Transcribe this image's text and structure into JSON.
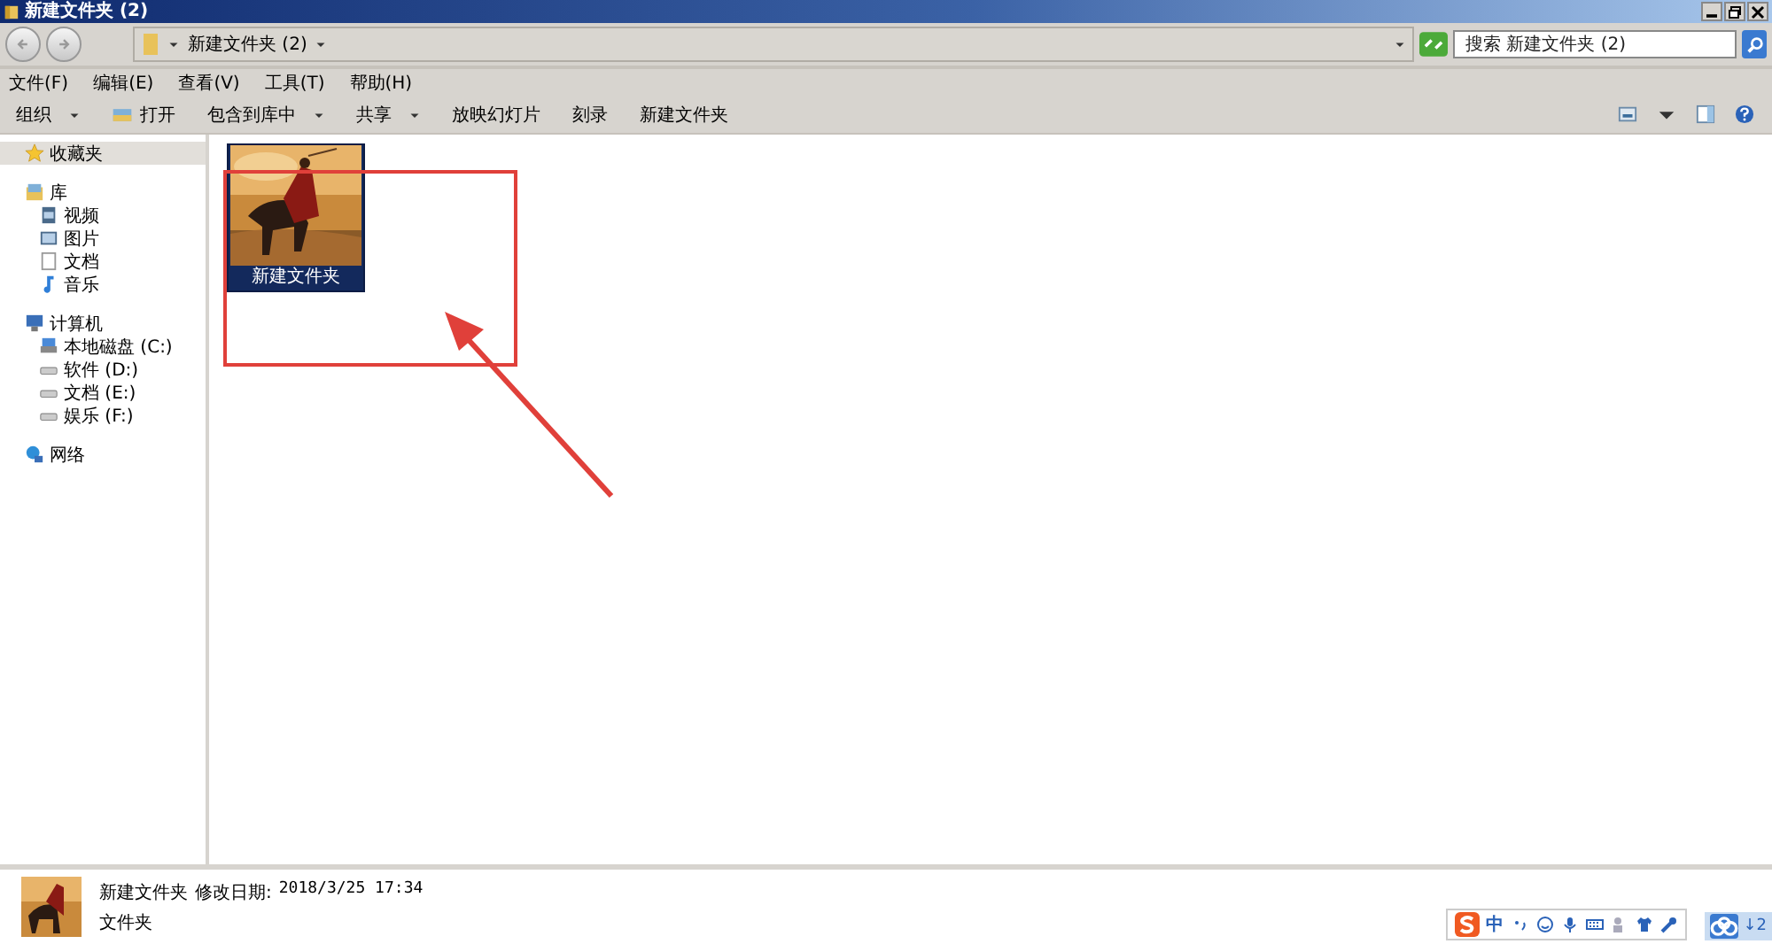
{
  "window": {
    "title": "新建文件夹 (2)"
  },
  "address": {
    "path": "新建文件夹 (2)"
  },
  "search": {
    "placeholder": "搜索 新建文件夹 (2)"
  },
  "menu": [
    "文件(F)",
    "编辑(E)",
    "查看(V)",
    "工具(T)",
    "帮助(H)"
  ],
  "toolbar": [
    {
      "label": "组织",
      "dropdown": true,
      "icon": false
    },
    {
      "label": "打开",
      "dropdown": false,
      "icon": true
    },
    {
      "label": "包含到库中",
      "dropdown": true,
      "icon": false
    },
    {
      "label": "共享",
      "dropdown": true,
      "icon": false
    },
    {
      "label": "放映幻灯片",
      "dropdown": false,
      "icon": false
    },
    {
      "label": "刻录",
      "dropdown": false,
      "icon": false
    },
    {
      "label": "新建文件夹",
      "dropdown": false,
      "icon": false
    }
  ],
  "sidebar": [
    {
      "label": "收藏夹",
      "kind": "star",
      "selected": true
    },
    {
      "label": "库",
      "kind": "library",
      "selected": false,
      "children": [
        {
          "label": "视频",
          "kind": "video",
          "selected": false
        },
        {
          "label": "图片",
          "kind": "picture",
          "selected": false
        },
        {
          "label": "文档",
          "kind": "document",
          "selected": false
        },
        {
          "label": "音乐",
          "kind": "music",
          "selected": false
        }
      ]
    },
    {
      "label": "计算机",
      "kind": "computer",
      "selected": false,
      "children": [
        {
          "label": "本地磁盘 (C:)",
          "kind": "system",
          "selected": false
        },
        {
          "label": "软件 (D:)",
          "kind": "drive",
          "selected": false
        },
        {
          "label": "文档 (E:)",
          "kind": "drive",
          "selected": false
        },
        {
          "label": "娱乐 (F:)",
          "kind": "drive",
          "selected": false
        }
      ]
    },
    {
      "label": "网络",
      "kind": "network",
      "selected": false
    }
  ],
  "files": [
    {
      "name": "新建文件夹",
      "selected": true,
      "kind": "picture"
    }
  ],
  "details": {
    "name": "新建文件夹",
    "date_label": "修改日期:",
    "date": "2018/3/25 17:34",
    "type": "文件夹",
    "kind": "picture"
  },
  "tray": {
    "ime_mode": "中",
    "download": "↓2"
  }
}
